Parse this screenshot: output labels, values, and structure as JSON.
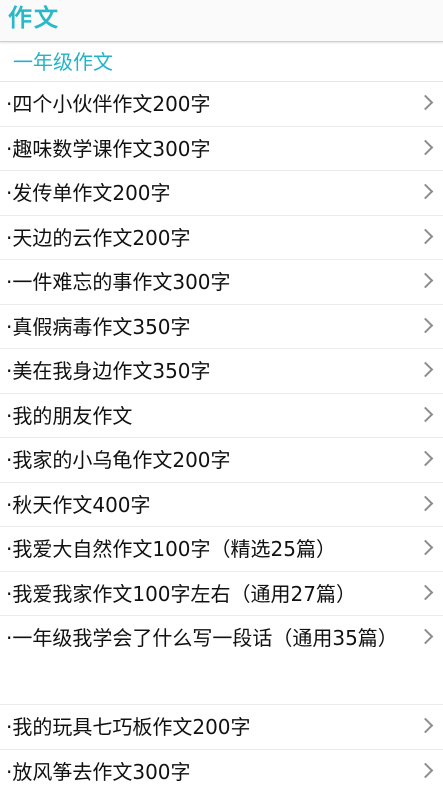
{
  "header": {
    "title": "作文"
  },
  "section": {
    "title": "一年级作文"
  },
  "items": [
    {
      "label": "·四个小伙伴作文200字"
    },
    {
      "label": "·趣味数学课作文300字"
    },
    {
      "label": "·发传单作文200字"
    },
    {
      "label": "·天边的云作文200字"
    },
    {
      "label": "·一件难忘的事作文300字"
    },
    {
      "label": "·真假病毒作文350字"
    },
    {
      "label": "·美在我身边作文350字"
    },
    {
      "label": "·我的朋友作文"
    },
    {
      "label": "·我家的小乌龟作文200字"
    },
    {
      "label": "·秋天作文400字"
    },
    {
      "label": "·我爱大自然作文100字（精选25篇）"
    },
    {
      "label": "·我爱我家作文100字左右（通用27篇）"
    },
    {
      "label": "·一年级我学会了什么写一段话（通用35篇）"
    },
    {
      "label": "·我的玩具七巧板作文200字"
    },
    {
      "label": "·放风筝去作文300字"
    }
  ]
}
